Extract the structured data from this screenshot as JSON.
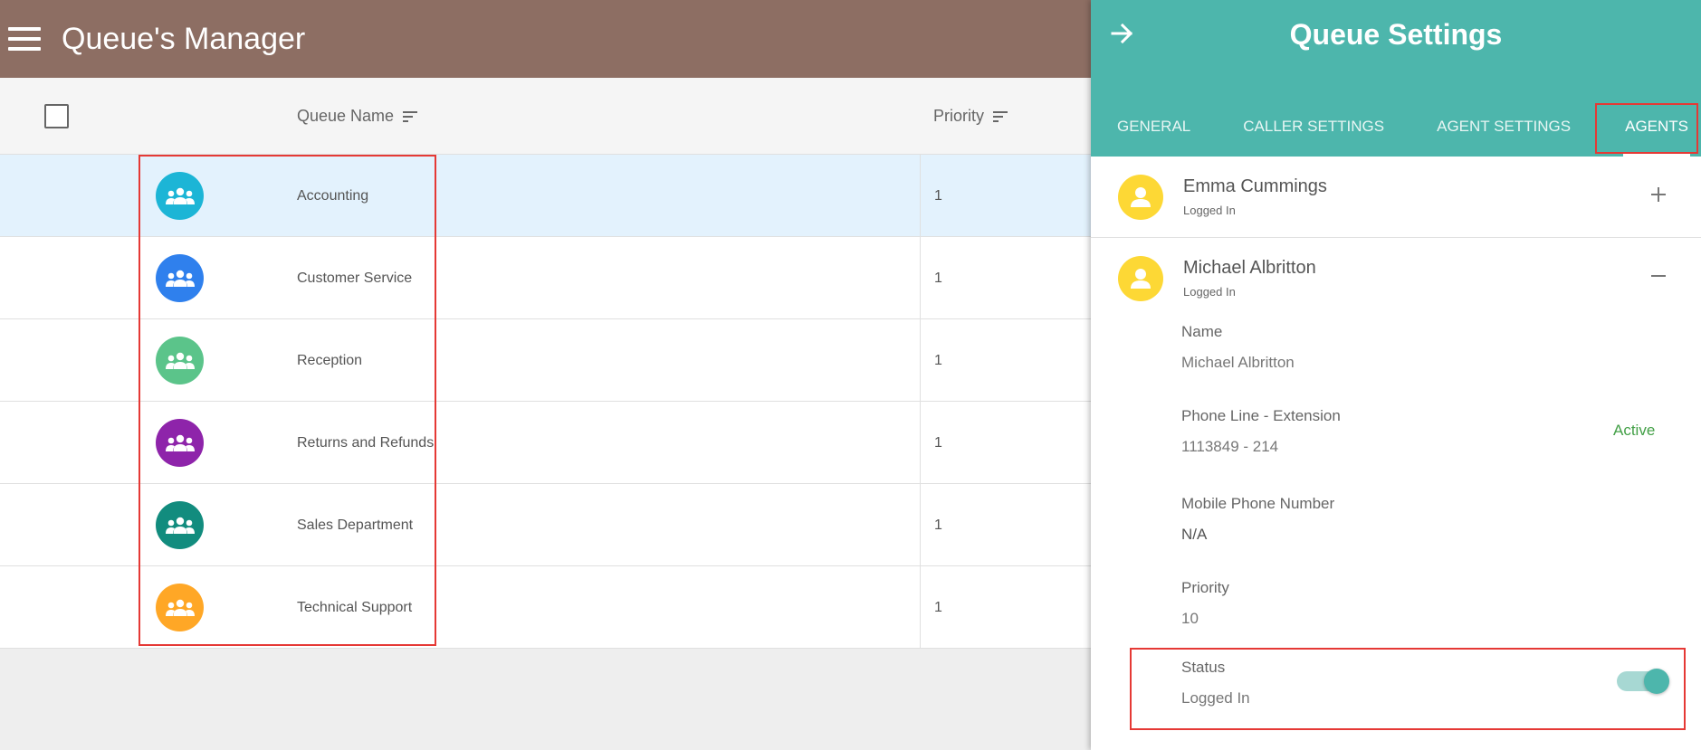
{
  "app": {
    "title": "Queue's Manager"
  },
  "table": {
    "columns": {
      "name": "Queue Name",
      "priority": "Priority"
    },
    "rows": [
      {
        "name": "Accounting",
        "priority": "1",
        "color": "#1cb5d6"
      },
      {
        "name": "Customer Service",
        "priority": "1",
        "color": "#2f80ed"
      },
      {
        "name": "Reception",
        "priority": "1",
        "color": "#5bc48a"
      },
      {
        "name": "Returns and Refunds",
        "priority": "1",
        "color": "#8e24aa"
      },
      {
        "name": "Sales Department",
        "priority": "1",
        "color": "#128c7e"
      },
      {
        "name": "Technical Support",
        "priority": "1",
        "color": "#ffa726"
      }
    ]
  },
  "panel": {
    "title": "Queue Settings",
    "tabs": [
      "GENERAL",
      "CALLER SETTINGS",
      "AGENT SETTINGS",
      "AGENTS"
    ],
    "agents": [
      {
        "name": "Emma Cummings",
        "status": "Logged In"
      },
      {
        "name": "Michael Albritton",
        "status": "Logged In"
      }
    ],
    "details": {
      "name_label": "Name",
      "name_value": "Michael Albritton",
      "phone_label": "Phone Line - Extension",
      "phone_value": "1113849 - 214",
      "phone_status": "Active",
      "mobile_label": "Mobile Phone Number",
      "mobile_value": "N/A",
      "priority_label": "Priority",
      "priority_value": "10",
      "status_label": "Status",
      "status_value": "Logged In",
      "status_toggle_on": true
    }
  },
  "colors": {
    "topbar": "#8d6e63",
    "panel_header": "#4db6ac",
    "highlight": "#e53935",
    "agent_avatar": "#fdd835",
    "active_text": "#43a047"
  }
}
